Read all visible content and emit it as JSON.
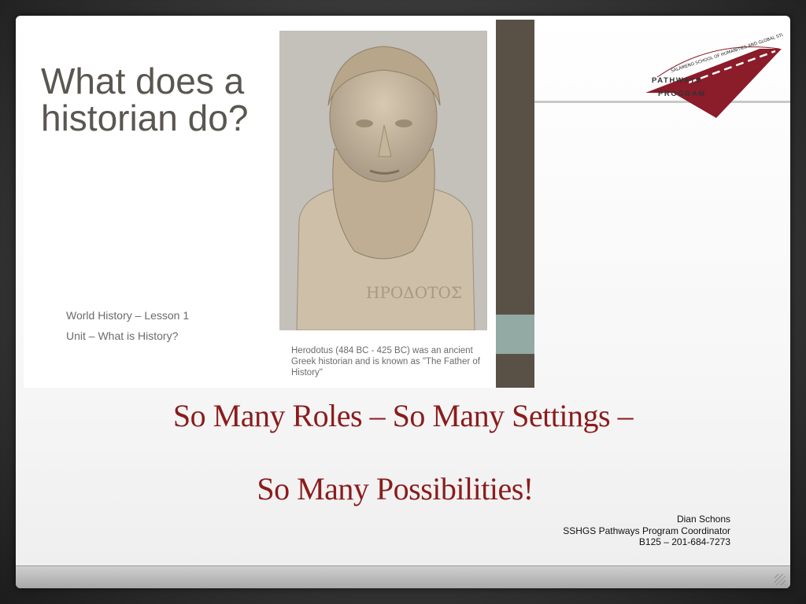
{
  "slide": {
    "embedded": {
      "question": "What does a historian do?",
      "lesson": "World History – Lesson 1",
      "unit": "Unit – What is History?",
      "caption": "Herodotus (484 BC - 425 BC) was an ancient Greek historian and is known as \"The Father of History\"",
      "image_label": "Herodotus bust"
    },
    "logo": {
      "arc_text": "SALAMENO SCHOOL OF HUMANITIES AND GLOBAL STUDIES",
      "line1": "PATHWAYS",
      "line2": "PROGRAM",
      "color": "#8b1c2a"
    },
    "title_line1": "So Many Roles – So Many Settings –",
    "title_line2": "So Many Possibilities!",
    "presenter": {
      "name": "Dian Schons",
      "role": "SSHGS Pathways Program Coordinator",
      "contact": "B125 – 201-684-7273"
    },
    "colors": {
      "title": "#8b1c1c",
      "stripe": "#5a5146",
      "stripe_accent": "#93aaa4"
    }
  }
}
